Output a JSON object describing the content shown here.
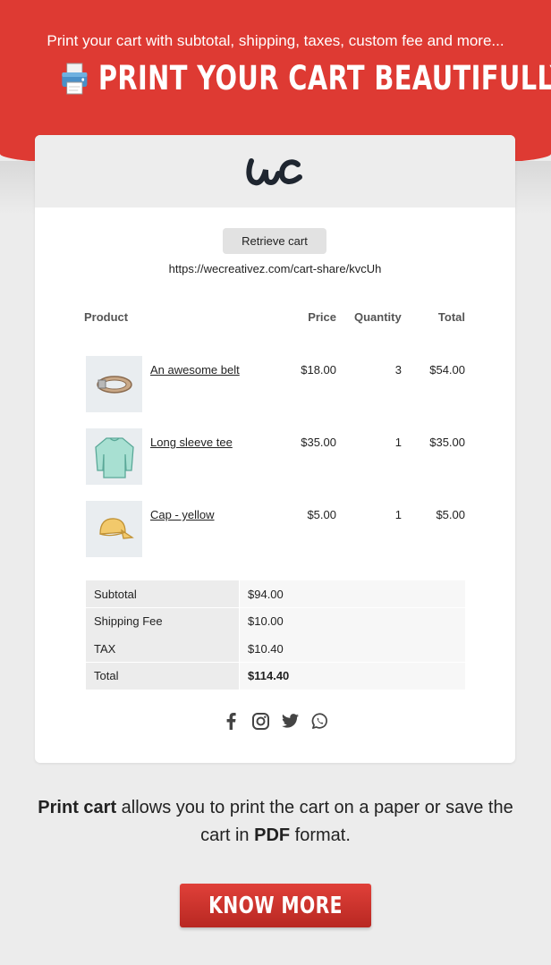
{
  "banner": {
    "tagline": "Print your cart with subtotal, shipping, taxes, custom fee and more...",
    "headline": "PRINT YOUR CART BEAUTIFULLY",
    "accent_color": "#de3a33",
    "icon": "printer-icon"
  },
  "card": {
    "logo_text": "uc",
    "retrieve_label": "Retrieve cart",
    "share_url": "https://wecreativez.com/cart-share/kvcUh",
    "headers": {
      "product": "Product",
      "price": "Price",
      "quantity": "Quantity",
      "total": "Total"
    },
    "items": [
      {
        "name": "An awesome belt",
        "price": "$18.00",
        "quantity": "3",
        "total": "$54.00",
        "icon": "belt-icon"
      },
      {
        "name": "Long sleeve tee",
        "price": "$35.00",
        "quantity": "1",
        "total": "$35.00",
        "icon": "tshirt-icon"
      },
      {
        "name": "Cap - yellow",
        "price": "$5.00",
        "quantity": "1",
        "total": "$5.00",
        "icon": "cap-icon"
      }
    ],
    "totals": [
      {
        "label": "Subtotal",
        "value": "$94.00"
      },
      {
        "label": "Shipping Fee",
        "value": "$10.00"
      },
      {
        "label": "TAX",
        "value": "$10.40"
      },
      {
        "label": "Total",
        "value": "$114.40"
      }
    ],
    "socials": [
      "facebook-icon",
      "instagram-icon",
      "twitter-icon",
      "whatsapp-icon"
    ]
  },
  "footer": {
    "desc_strong1": "Print cart",
    "desc_mid": " allows you to print the cart on a paper or save the cart in ",
    "desc_strong2": "PDF",
    "desc_end": " format.",
    "cta_label": "KNOW MORE"
  }
}
